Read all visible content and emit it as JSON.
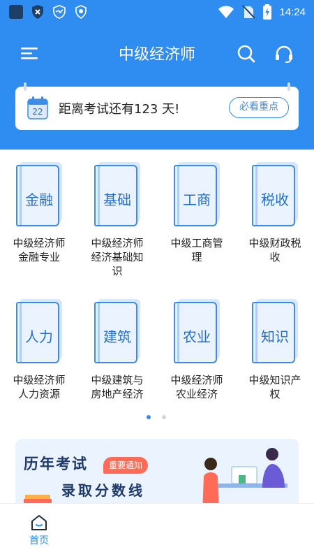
{
  "status_bar": {
    "time": "14:24",
    "icons": [
      "app-square-icon",
      "shield-x-icon",
      "bird-shield-icon",
      "shield-icon",
      "wifi-icon",
      "no-sim-icon",
      "battery-charging-icon"
    ]
  },
  "header": {
    "title": "中级经济师",
    "menu_icon": "menu-icon",
    "search_icon": "search-icon",
    "support_icon": "headset-icon"
  },
  "countdown": {
    "calendar_day": "22",
    "text": "距离考试还有123 天!",
    "button_label": "必看重点"
  },
  "courses": [
    {
      "cover": "金融",
      "label": "中级经济师金融专业"
    },
    {
      "cover": "基础",
      "label": "中级经济师经济基础知识"
    },
    {
      "cover": "工商",
      "label": "中级工商管理"
    },
    {
      "cover": "税收",
      "label": "中级财政税收"
    },
    {
      "cover": "人力",
      "label": "中级经济师人力资源"
    },
    {
      "cover": "建筑",
      "label": "中级建筑与房地产经济"
    },
    {
      "cover": "农业",
      "label": "中级经济师农业经济"
    },
    {
      "cover": "知识",
      "label": "中级知识产权"
    }
  ],
  "pager": {
    "active_index": 0,
    "total": 2
  },
  "banner": {
    "title": "历年考试",
    "badge": "重要通知",
    "subtitle": "录取分数线"
  },
  "bottom_nav": {
    "home_label": "首页"
  },
  "colors": {
    "primary": "#2f8cf0",
    "badge": "#ff6b57",
    "banner_bg": "#eaf3ff"
  }
}
